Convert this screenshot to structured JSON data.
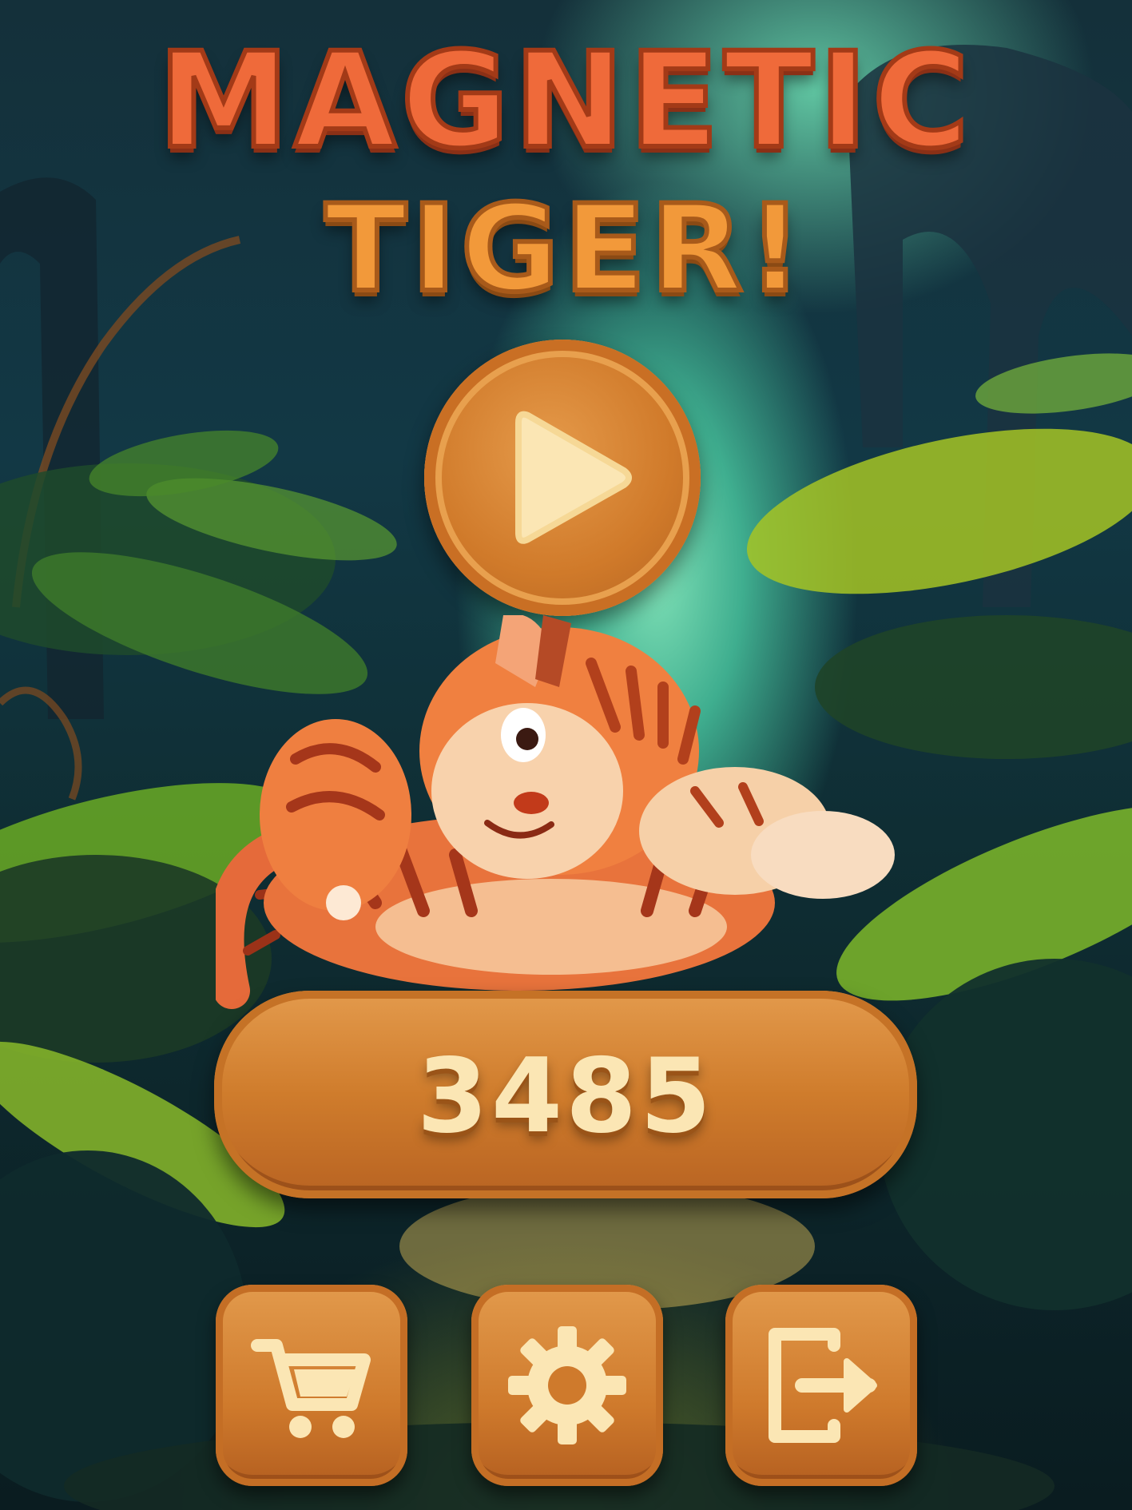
{
  "title": {
    "line1": "MAGNETIC",
    "line2": "TIGER!"
  },
  "score": {
    "value": "3485"
  },
  "buttons": {
    "play_icon": "play-icon",
    "shop_icon": "shopping-cart-icon",
    "settings_icon": "gear-icon",
    "exit_icon": "exit-icon"
  },
  "colors": {
    "title_line1": "#ef6a3a",
    "title_line2": "#f2993a",
    "wood": "#cf7a2c",
    "icon_cream": "#fbe6b4"
  }
}
